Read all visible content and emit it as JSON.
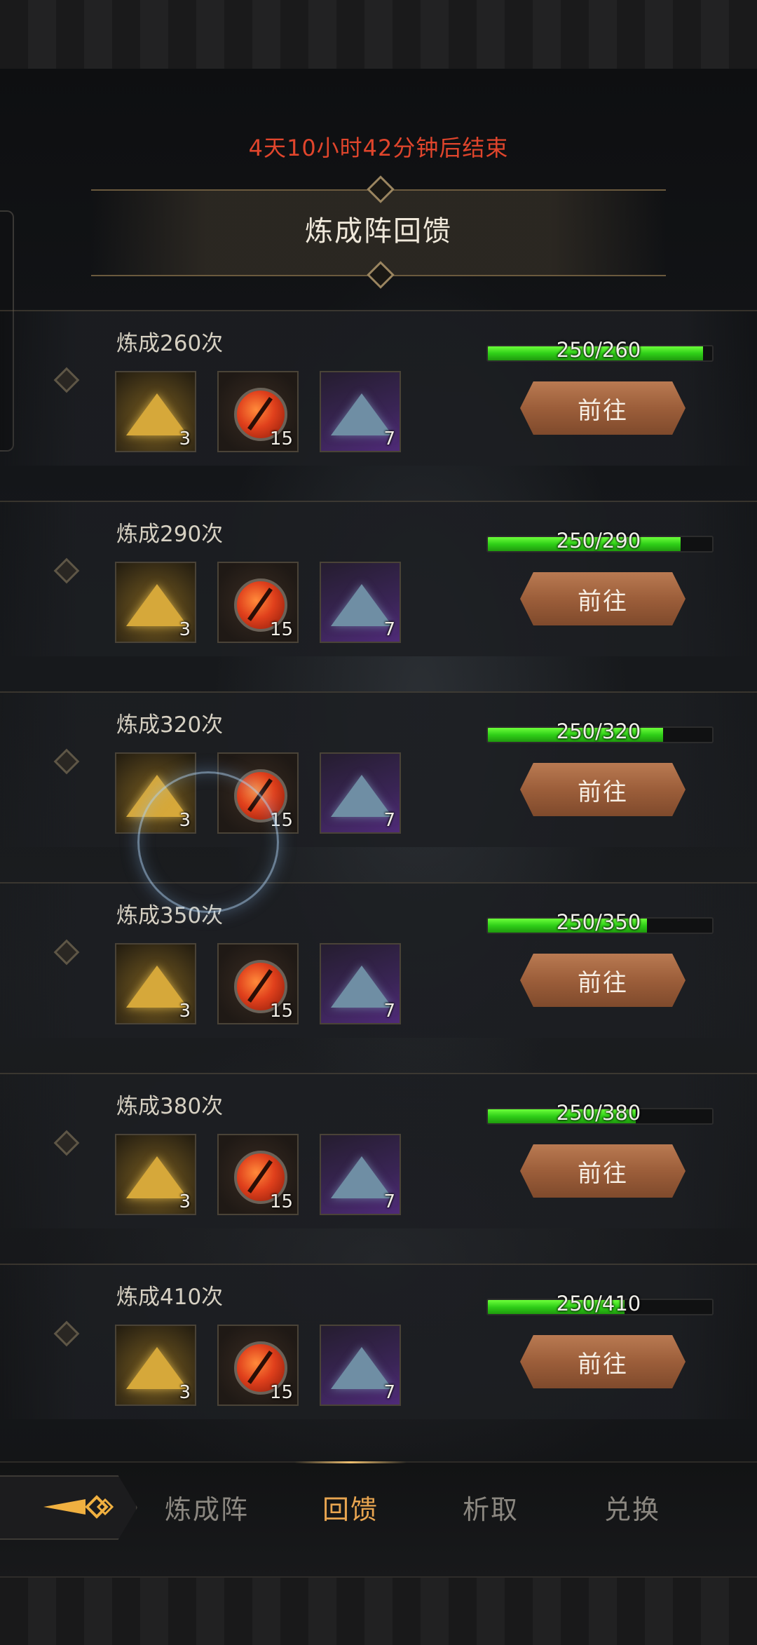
{
  "timer": "4天10小时42分钟后结束",
  "title": "炼成阵回馈",
  "rows": [
    {
      "label": "炼成260次",
      "progress_text": "250/260",
      "progress": 0.96,
      "items": [
        "3",
        "15",
        "7"
      ],
      "button": "前往"
    },
    {
      "label": "炼成290次",
      "progress_text": "250/290",
      "progress": 0.86,
      "items": [
        "3",
        "15",
        "7"
      ],
      "button": "前往"
    },
    {
      "label": "炼成320次",
      "progress_text": "250/320",
      "progress": 0.78,
      "items": [
        "3",
        "15",
        "7"
      ],
      "button": "前往"
    },
    {
      "label": "炼成350次",
      "progress_text": "250/350",
      "progress": 0.71,
      "items": [
        "3",
        "15",
        "7"
      ],
      "button": "前往"
    },
    {
      "label": "炼成380次",
      "progress_text": "250/380",
      "progress": 0.66,
      "items": [
        "3",
        "15",
        "7"
      ],
      "button": "前往"
    },
    {
      "label": "炼成410次",
      "progress_text": "250/410",
      "progress": 0.61,
      "items": [
        "3",
        "15",
        "7"
      ],
      "button": "前往"
    }
  ],
  "nav": {
    "tabs": [
      {
        "label": "炼成阵",
        "active": false
      },
      {
        "label": "回馈",
        "active": true
      },
      {
        "label": "析取",
        "active": false
      },
      {
        "label": "兑换",
        "active": false
      }
    ]
  },
  "colors": {
    "timer": "#e0452c",
    "accent": "#e8a550",
    "progress": "#2fcf18",
    "button": "#9c5e3a"
  }
}
